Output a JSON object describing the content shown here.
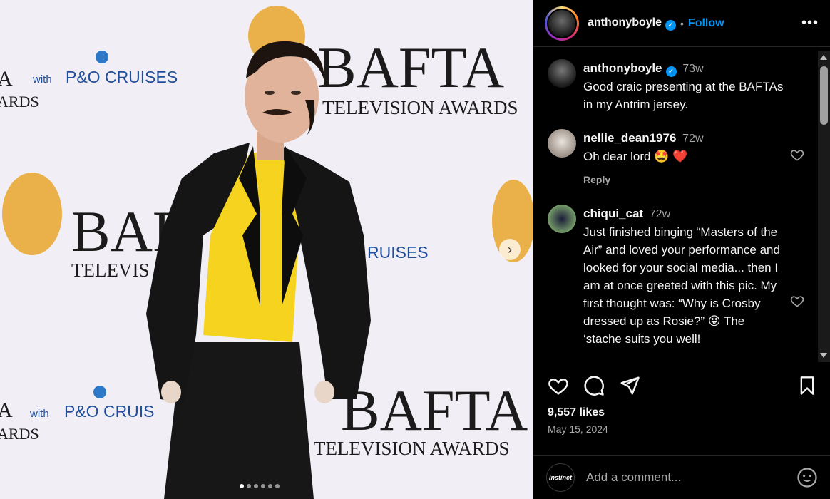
{
  "post": {
    "username": "anthonyboyle",
    "follow_label": "Follow",
    "separator": "•",
    "more_label": "•••",
    "likes": "9,557 likes",
    "date": "May 15, 2024"
  },
  "photo": {
    "backdrop_texts": {
      "bafta": "BAFTA",
      "tv_awards": "TELEVISION AWARDS",
      "with": "with",
      "po_cruises": "P&O CRUISES",
      "ards": "ARDS",
      "a": "A",
      "bafta_partial": "BAF",
      "televis_partial": "TELEVIS",
      "ruises_partial": "RUISES",
      "cruis_partial": "P&O CRUIS"
    },
    "carousel_dots": 6,
    "active_dot": 0
  },
  "comments": [
    {
      "username": "anthonyboyle",
      "time": "73w",
      "text": "Good craic presenting at the BAFTAs in my Antrim jersey.",
      "verified": true
    },
    {
      "username": "nellie_dean1976",
      "time": "72w",
      "text": "Oh dear lord 🤩 ❤️",
      "reply": "Reply"
    },
    {
      "username": "chiqui_cat",
      "time": "72w",
      "text": "Just finished binging “Masters of the Air” and loved your performance and looked for your social media... then I am at once greeted with this pic. My first thought was: “Why is Crosby dressed up as Rosie?” 😝 The ‘stache suits you well!"
    }
  ],
  "add_comment": {
    "avatar_text": "instinct",
    "placeholder": "Add a comment..."
  },
  "colors": {
    "accent": "#0095f6",
    "background": "#000000",
    "muted": "#a8a8a8",
    "bafta_gold": "#e8a93c",
    "po_blue": "#1f4e9c"
  }
}
